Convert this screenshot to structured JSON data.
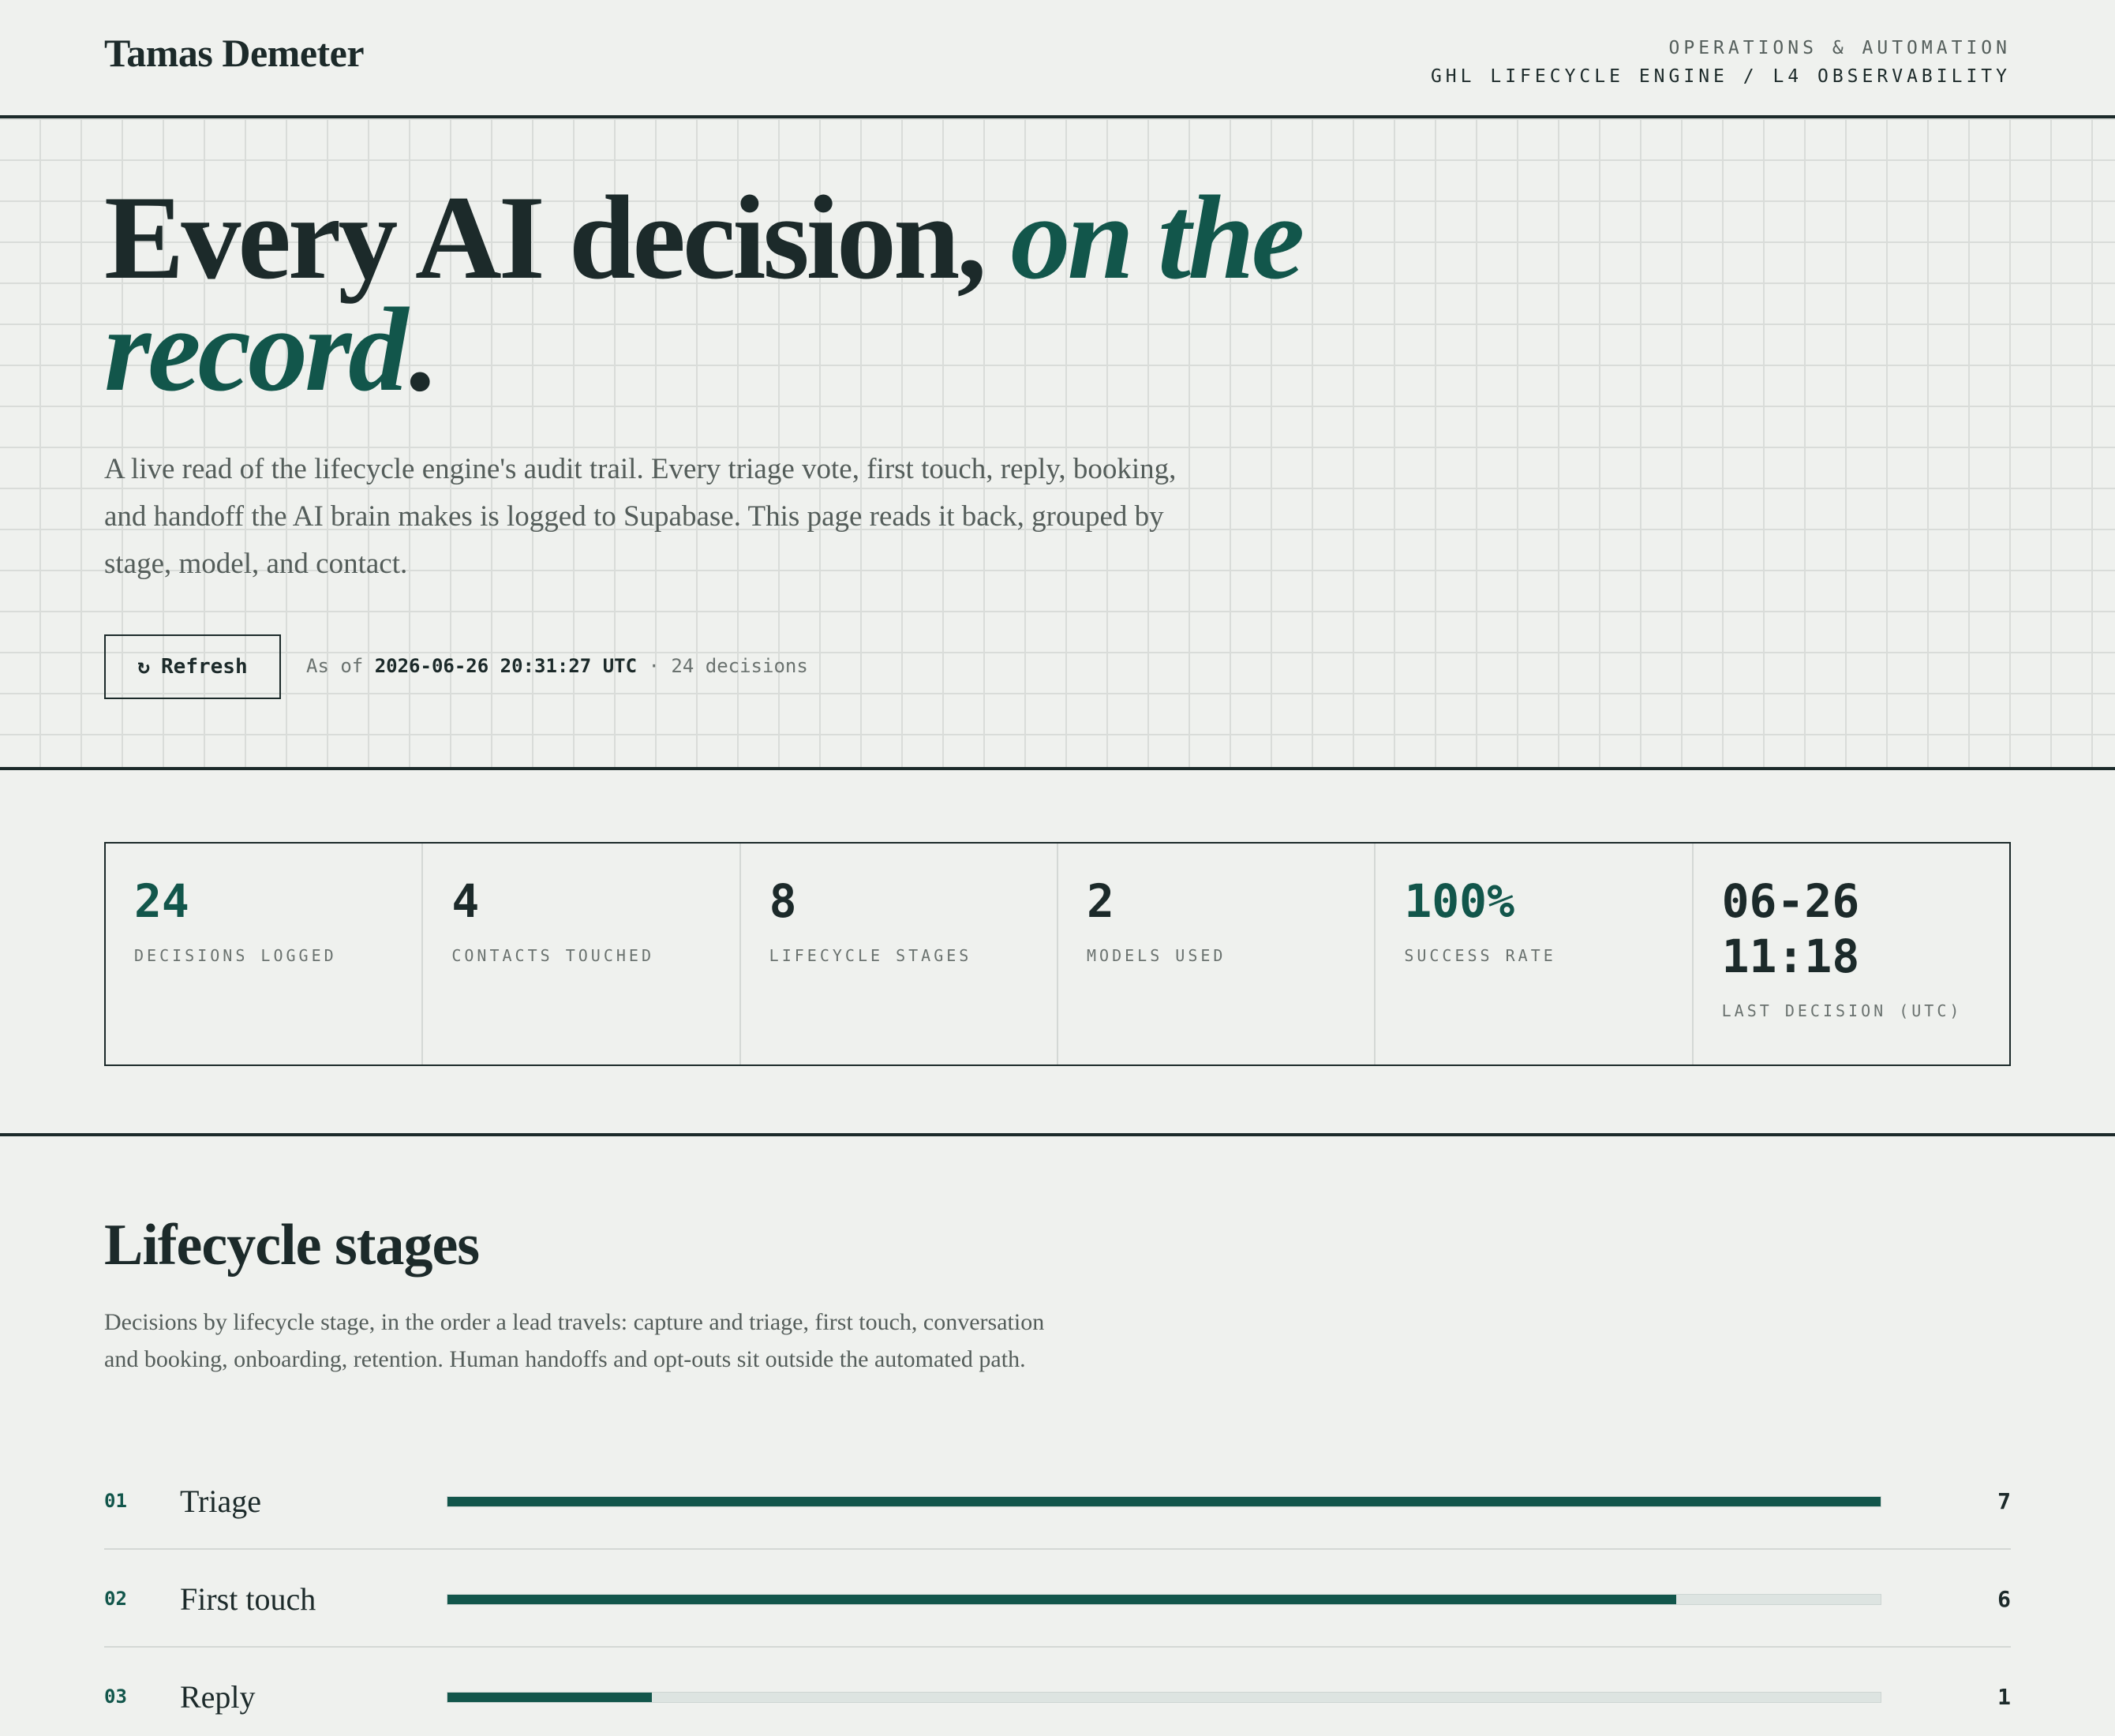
{
  "header": {
    "brand": "Tamas Demeter",
    "kicker": "OPERATIONS & AUTOMATION",
    "subtitle": "GHL LIFECYCLE ENGINE / L4 OBSERVABILITY"
  },
  "hero": {
    "headline_plain": "Every AI decision,",
    "headline_italic": "on the record",
    "headline_end": ".",
    "lede": "A live read of the lifecycle engine's audit trail. Every triage vote, first touch, reply, booking, and handoff the AI brain makes is logged to Supabase. This page reads it back, grouped by stage, model, and contact.",
    "refresh_icon": "refresh-icon",
    "refresh_glyph": "↻",
    "refresh_label": "Refresh",
    "asof_prefix": "As of",
    "asof_timestamp": "2026-06-26 20:31:27 UTC",
    "asof_separator": "·",
    "asof_count": "24 decisions"
  },
  "stats": [
    {
      "value": "24",
      "label": "DECISIONS LOGGED",
      "accent": true
    },
    {
      "value": "4",
      "label": "CONTACTS TOUCHED",
      "accent": false
    },
    {
      "value": "8",
      "label": "LIFECYCLE STAGES",
      "accent": false
    },
    {
      "value": "2",
      "label": "MODELS USED",
      "accent": false
    },
    {
      "value": "100%",
      "label": "SUCCESS RATE",
      "accent": true
    },
    {
      "value": "06-26 11:18",
      "value_line1": "06-26",
      "value_line2": "11:18",
      "label": "LAST DECISION (UTC)",
      "accent": false
    }
  ],
  "lifecycle": {
    "title": "Lifecycle stages",
    "description": "Decisions by lifecycle stage, in the order a lead travels: capture and triage, first touch, conversation and booking, onboarding, retention. Human handoffs and opt-outs sit outside the automated path.",
    "max": 7,
    "rows": [
      {
        "num": "01",
        "name": "Triage",
        "count": 7
      },
      {
        "num": "02",
        "name": "First touch",
        "count": 6
      },
      {
        "num": "03",
        "name": "Reply",
        "count": 1
      }
    ]
  },
  "colors": {
    "accent": "#12564b",
    "ink": "#1c2a2a",
    "background": "#eff1ee"
  }
}
